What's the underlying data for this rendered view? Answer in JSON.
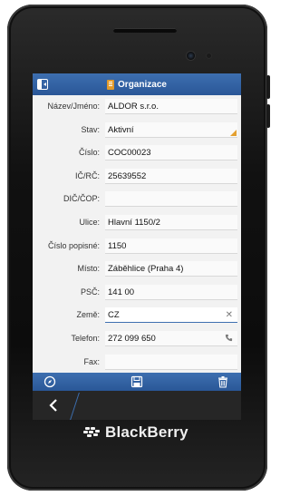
{
  "app": {
    "title": "Organizace"
  },
  "form": {
    "fields": [
      {
        "label": "Název/Jméno:",
        "value": "ALDOR s.r.o."
      },
      {
        "label": "Stav:",
        "value": "Aktivní"
      },
      {
        "label": "Číslo:",
        "value": "COC00023"
      },
      {
        "label": "IČ/RČ:",
        "value": "25639552"
      },
      {
        "label": "DIČ/ČOP:",
        "value": ""
      },
      {
        "label": "Ulice:",
        "value": "Hlavní 1150/2"
      },
      {
        "label": "Číslo popisné:",
        "value": "1150"
      },
      {
        "label": "Místo:",
        "value": "Záběhlice (Praha 4)"
      },
      {
        "label": "PSČ:",
        "value": "141 00"
      },
      {
        "label": "Země:",
        "value": "CZ"
      },
      {
        "label": "Telefon:",
        "value": "272 099 650"
      },
      {
        "label": "Fax:",
        "value": ""
      }
    ]
  },
  "device": {
    "brand": "BlackBerry"
  },
  "colors": {
    "accent": "#2f5fa3",
    "dropdown": "#e3a030",
    "background": "#f2f2f2"
  },
  "icons": {
    "titlebar_left": "sidebar-toggle-icon",
    "titlebar_title": "folder-icon",
    "action_left": "compass-icon",
    "action_center": "save-icon",
    "action_right": "delete-icon",
    "nav_back": "back-arrow-icon"
  }
}
